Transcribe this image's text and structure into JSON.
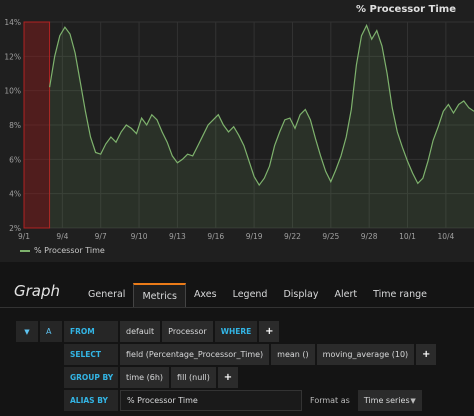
{
  "panel": {
    "title": "% Processor Time",
    "legend": "% Processor Time"
  },
  "chart_data": {
    "type": "line",
    "y_tick_labels": [
      "14%",
      "12%",
      "10%",
      "8%",
      "6%",
      "4%",
      "2%"
    ],
    "y_ticks": [
      14,
      12,
      10,
      8,
      6,
      4,
      2
    ],
    "ylim": [
      2,
      14
    ],
    "x_tick_labels": [
      "9/1",
      "9/4",
      "9/7",
      "9/10",
      "9/13",
      "9/16",
      "9/19",
      "9/22",
      "9/25",
      "9/28",
      "10/1",
      "10/4"
    ],
    "x_ticks": [
      0,
      3,
      6,
      9,
      12,
      15,
      18,
      21,
      24,
      27,
      30,
      33
    ],
    "xlim": [
      0,
      35.2
    ],
    "grid": true,
    "highlight_region": [
      0,
      2.0
    ],
    "series": [
      {
        "name": "% Processor Time",
        "color": "#7eb26d",
        "x": [
          2.0,
          2.4,
          2.8,
          3.2,
          3.6,
          4.0,
          4.4,
          4.8,
          5.2,
          5.6,
          6.0,
          6.4,
          6.8,
          7.2,
          7.6,
          8.0,
          8.4,
          8.8,
          9.2,
          9.6,
          10.0,
          10.4,
          10.8,
          11.2,
          11.6,
          12.0,
          12.4,
          12.8,
          13.2,
          13.6,
          14.0,
          14.4,
          14.8,
          15.2,
          15.6,
          16.0,
          16.4,
          16.8,
          17.2,
          17.6,
          18.0,
          18.4,
          18.8,
          19.2,
          19.6,
          20.0,
          20.4,
          20.8,
          21.2,
          21.6,
          22.0,
          22.4,
          22.8,
          23.2,
          23.6,
          24.0,
          24.4,
          24.8,
          25.2,
          25.6,
          26.0,
          26.4,
          26.8,
          27.2,
          27.6,
          28.0,
          28.4,
          28.8,
          29.2,
          29.6,
          30.0,
          30.4,
          30.8,
          31.2,
          31.6,
          32.0,
          32.4,
          32.8,
          33.2,
          33.6,
          34.0,
          34.4,
          34.8,
          35.2
        ],
        "values": [
          10.2,
          12.0,
          13.2,
          13.7,
          13.3,
          12.2,
          10.5,
          8.8,
          7.3,
          6.4,
          6.3,
          6.9,
          7.3,
          7.0,
          7.6,
          8.0,
          7.8,
          7.5,
          8.4,
          8.0,
          8.6,
          8.3,
          7.6,
          7.0,
          6.2,
          5.8,
          6.0,
          6.3,
          6.2,
          6.8,
          7.4,
          8.0,
          8.3,
          8.6,
          8.0,
          7.6,
          7.9,
          7.4,
          6.8,
          5.9,
          5.0,
          4.5,
          4.9,
          5.6,
          6.8,
          7.6,
          8.3,
          8.4,
          7.8,
          8.6,
          8.9,
          8.3,
          7.2,
          6.2,
          5.3,
          4.7,
          5.4,
          6.2,
          7.3,
          8.9,
          11.5,
          13.2,
          13.8,
          13.0,
          13.5,
          12.6,
          11.0,
          9.0,
          7.6,
          6.7,
          5.9,
          5.2,
          4.6,
          4.9,
          5.9,
          7.1,
          7.9,
          8.8,
          9.2,
          8.7,
          9.2,
          9.4,
          9.0,
          8.8
        ]
      }
    ]
  },
  "editor": {
    "title": "Graph",
    "tabs": [
      "General",
      "Metrics",
      "Axes",
      "Legend",
      "Display",
      "Alert",
      "Time range"
    ],
    "active_tab": "Metrics",
    "collapse_icon": "caret-down-icon",
    "query": {
      "ref_id": "A",
      "from": {
        "keyword": "FROM",
        "policy": "default",
        "measurement": "Processor",
        "where_keyword": "WHERE"
      },
      "select": {
        "keyword": "SELECT",
        "field": "field (Percentage_Processor_Time)",
        "agg": "mean ()",
        "transform": "moving_average (10)"
      },
      "group_by": {
        "keyword": "GROUP BY",
        "time": "time (6h)",
        "fill": "fill (null)"
      },
      "alias": {
        "keyword": "ALIAS BY",
        "value": "% Processor Time",
        "format_label": "Format as",
        "format_value": "Time series"
      }
    },
    "plus_label": "+"
  },
  "colors": {
    "accent": "#eb7b18",
    "keyword": "#33b5e5",
    "series": "#7eb26d",
    "highlight": "#8b1a1a"
  }
}
